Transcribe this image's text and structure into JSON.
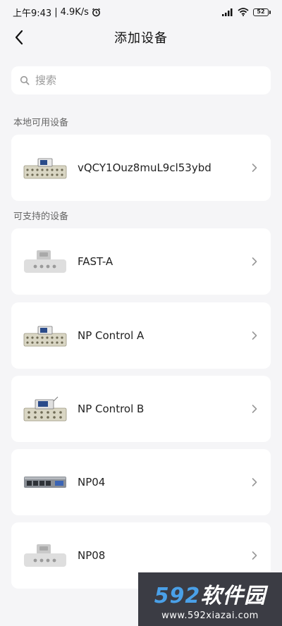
{
  "status_bar": {
    "time": "上午9:43",
    "network_speed": "4.9K/s",
    "separator": "|",
    "battery_level": "52",
    "icons": [
      "alarm-icon",
      "signal-icon",
      "wifi-icon",
      "battery-icon"
    ]
  },
  "header": {
    "title": "添加设备",
    "back_icon": "chevron-left-icon"
  },
  "search": {
    "placeholder": "搜索",
    "value": ""
  },
  "sections": {
    "local": {
      "label": "本地可用设备",
      "devices": [
        {
          "name": "vQCY1Ouz8muL9cl53ybd",
          "thumb": "switch-with-display"
        }
      ]
    },
    "supported": {
      "label": "可支持的设备",
      "devices": [
        {
          "name": "FAST-A",
          "thumb": "adapter-box"
        },
        {
          "name": "NP Control A",
          "thumb": "switch-with-display"
        },
        {
          "name": "NP Control B",
          "thumb": "switch-with-display-antenna"
        },
        {
          "name": "NP04",
          "thumb": "ethernet-switch"
        },
        {
          "name": "NP08",
          "thumb": "adapter-box"
        }
      ]
    }
  },
  "watermark": {
    "logo_num": "592",
    "logo_text": "软件园",
    "url": "www.592xiazai.com"
  },
  "colors": {
    "background": "#f5f5f7",
    "card": "#ffffff",
    "watermark_bg": "#3b3c44",
    "watermark_accent": "#4aa0e8"
  }
}
